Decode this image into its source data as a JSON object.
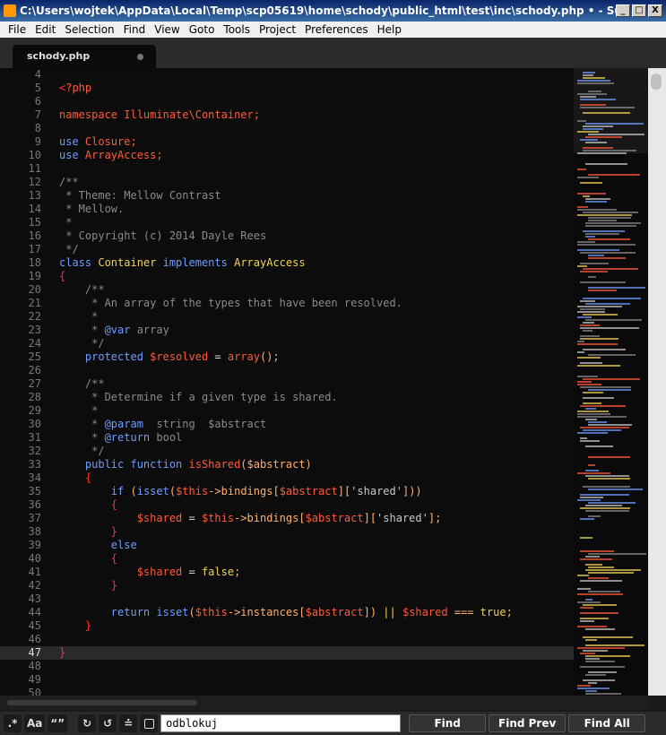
{
  "window": {
    "title": "C:\\Users\\wojtek\\AppData\\Local\\Temp\\scp05619\\home\\schody\\public_html\\test\\inc\\schody.php • - Sublime Tex...",
    "minimize": "_",
    "maximize": "□",
    "close": "X"
  },
  "menu": [
    "File",
    "Edit",
    "Selection",
    "Find",
    "View",
    "Goto",
    "Tools",
    "Project",
    "Preferences",
    "Help"
  ],
  "tab": {
    "label": "schody.php"
  },
  "gutter": [
    "4",
    "5",
    "6",
    "7",
    "8",
    "9",
    "10",
    "11",
    "12",
    "13",
    "14",
    "15",
    "16",
    "17",
    "18",
    "19",
    "20",
    "21",
    "22",
    "23",
    "24",
    "25",
    "26",
    "27",
    "28",
    "29",
    "30",
    "31",
    "32",
    "33",
    "34",
    "35",
    "36",
    "37",
    "38",
    "39",
    "40",
    "41",
    "42",
    "43",
    "44",
    "45",
    "46",
    "47",
    "48",
    "49",
    "50"
  ],
  "current_line_index": 43,
  "code_lines": [
    [],
    [
      [
        "br",
        "<"
      ],
      [
        "kw",
        "?php"
      ]
    ],
    [],
    [
      [
        "kw",
        "namespace "
      ],
      [
        "ns",
        "Illuminate\\Container;"
      ]
    ],
    [],
    [
      [
        "bl",
        "use "
      ],
      [
        "kw",
        "Closure;"
      ]
    ],
    [
      [
        "bl",
        "use "
      ],
      [
        "kw",
        "ArrayAccess;"
      ]
    ],
    [],
    [
      [
        "cm",
        "/**"
      ]
    ],
    [
      [
        "cm",
        " * Theme: Mellow Contrast"
      ]
    ],
    [
      [
        "cm",
        " * Mellow."
      ]
    ],
    [
      [
        "cm",
        " *"
      ]
    ],
    [
      [
        "cm",
        " * Copyright (c) 2014 Dayle Rees"
      ]
    ],
    [
      [
        "cm",
        " */"
      ]
    ],
    [
      [
        "bl",
        "class "
      ],
      [
        "cl",
        "Container "
      ],
      [
        "bl",
        "implements "
      ],
      [
        "cl",
        "ArrayAccess"
      ]
    ],
    [
      [
        "br",
        "{"
      ]
    ],
    [
      [
        "cm",
        "    /**"
      ]
    ],
    [
      [
        "cm",
        "     * An array of the types that have been resolved."
      ]
    ],
    [
      [
        "cm",
        "     *"
      ]
    ],
    [
      [
        "cm",
        "     * "
      ],
      [
        "ca",
        "@var"
      ],
      [
        "cm",
        " array"
      ]
    ],
    [
      [
        "cm",
        "     */"
      ]
    ],
    [
      [
        "tx",
        "    "
      ],
      [
        "bl",
        "protected "
      ],
      [
        "var",
        "$resolved "
      ],
      [
        "tx",
        "= "
      ],
      [
        "fn",
        "array"
      ],
      [
        "pn",
        "();"
      ]
    ],
    [],
    [
      [
        "cm",
        "    /**"
      ]
    ],
    [
      [
        "cm",
        "     * Determine if a given type is shared."
      ]
    ],
    [
      [
        "cm",
        "     *"
      ]
    ],
    [
      [
        "cm",
        "     * "
      ],
      [
        "ca",
        "@param"
      ],
      [
        "cm",
        "  string  $abstract"
      ]
    ],
    [
      [
        "cm",
        "     * "
      ],
      [
        "ca",
        "@return"
      ],
      [
        "cm",
        " bool"
      ]
    ],
    [
      [
        "cm",
        "     */"
      ]
    ],
    [
      [
        "tx",
        "    "
      ],
      [
        "bl",
        "public function "
      ],
      [
        "fn",
        "isShared"
      ],
      [
        "pn",
        "($abstract)"
      ]
    ],
    [
      [
        "tx",
        "    "
      ],
      [
        "br",
        "{"
      ]
    ],
    [
      [
        "tx",
        "        "
      ],
      [
        "bl",
        "if "
      ],
      [
        "pn",
        "("
      ],
      [
        "bl",
        "isset"
      ],
      [
        "pn",
        "("
      ],
      [
        "var",
        "$this"
      ],
      [
        "pn",
        "->bindings["
      ],
      [
        "var",
        "$abstract"
      ],
      [
        "pn",
        "]["
      ],
      [
        "st",
        "'shared'"
      ],
      [
        "pn",
        "]))"
      ]
    ],
    [
      [
        "tx",
        "        "
      ],
      [
        "br",
        "{"
      ]
    ],
    [
      [
        "tx",
        "            "
      ],
      [
        "var",
        "$shared "
      ],
      [
        "tx",
        "= "
      ],
      [
        "var",
        "$this"
      ],
      [
        "pn",
        "->bindings["
      ],
      [
        "var",
        "$abstract"
      ],
      [
        "pn",
        "]["
      ],
      [
        "st",
        "'shared'"
      ],
      [
        "pn",
        "];"
      ]
    ],
    [
      [
        "tx",
        "        "
      ],
      [
        "br",
        "}"
      ]
    ],
    [
      [
        "tx",
        "        "
      ],
      [
        "bl",
        "else"
      ]
    ],
    [
      [
        "tx",
        "        "
      ],
      [
        "br",
        "{"
      ]
    ],
    [
      [
        "tx",
        "            "
      ],
      [
        "var",
        "$shared "
      ],
      [
        "tx",
        "= "
      ],
      [
        "bt",
        "false"
      ],
      [
        "pn",
        ";"
      ]
    ],
    [
      [
        "tx",
        "        "
      ],
      [
        "br",
        "}"
      ]
    ],
    [],
    [
      [
        "tx",
        "        "
      ],
      [
        "bl",
        "return "
      ],
      [
        "bl",
        "isset"
      ],
      [
        "pn",
        "("
      ],
      [
        "var",
        "$this"
      ],
      [
        "pn",
        "->instances["
      ],
      [
        "var",
        "$abstract"
      ],
      [
        "pn",
        "]) "
      ],
      [
        "bt",
        "|| "
      ],
      [
        "var",
        "$shared "
      ],
      [
        "pn",
        "=== "
      ],
      [
        "bt",
        "true"
      ],
      [
        "pn",
        ";"
      ]
    ],
    [
      [
        "tx",
        "    "
      ],
      [
        "br",
        "}"
      ]
    ],
    [],
    [
      [
        "br",
        "}"
      ]
    ],
    [],
    [],
    []
  ],
  "find": {
    "regex_toggle": ".*",
    "case_toggle": "Aa",
    "word_toggle": "“”",
    "wrap_toggle": "↻",
    "in_selection_toggle": "↺",
    "highlight_toggle": "≐",
    "query": "odblokuj",
    "find_label": "Find",
    "find_prev_label": "Find Prev",
    "find_all_label": "Find All"
  }
}
